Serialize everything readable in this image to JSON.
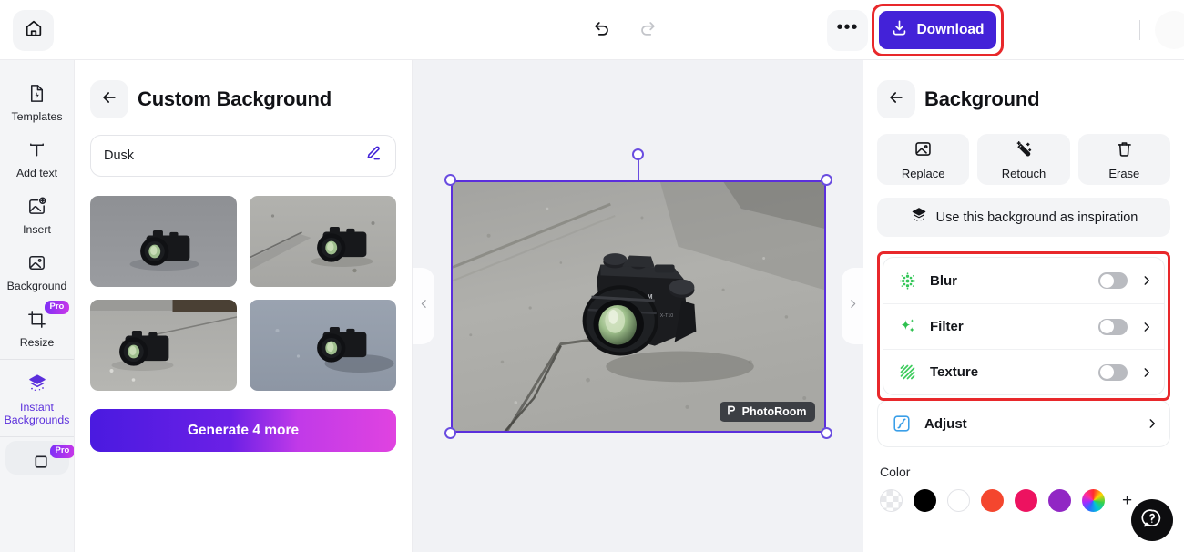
{
  "topbar": {
    "home_icon": "home-icon",
    "undo_icon": "undo-icon",
    "redo_icon": "redo-icon",
    "more_label": "•••",
    "download_label": "Download",
    "download_icon": "download-icon",
    "download_color": "#4322d8",
    "highlight_color": "#e8282b"
  },
  "rail": {
    "items": [
      {
        "label": "Templates",
        "icon": "templates-icon",
        "pro": false,
        "active": false
      },
      {
        "label": "Add text",
        "icon": "text-icon",
        "pro": false,
        "active": false
      },
      {
        "label": "Insert",
        "icon": "insert-image-icon",
        "pro": false,
        "active": false
      },
      {
        "label": "Background",
        "icon": "background-image-icon",
        "pro": false,
        "active": false
      },
      {
        "label": "Resize",
        "icon": "crop-resize-icon",
        "pro": true,
        "active": false
      },
      {
        "label": "Instant\nBackgrounds",
        "icon": "layers-sparkle-icon",
        "pro": false,
        "active": true
      }
    ],
    "pro_badge": "Pro",
    "active_color": "#5b2fdc",
    "partial_item": {
      "label": "",
      "icon": "shadow-icon",
      "pro": true
    }
  },
  "panel": {
    "back_icon": "arrow-left-icon",
    "title": "Custom Background",
    "prompt_value": "Dusk",
    "prompt_edit_icon": "pencil-edit-icon",
    "thumbnails": [
      {
        "name": "variation-1",
        "tone": "gray-smooth"
      },
      {
        "name": "variation-2",
        "tone": "concrete-crack"
      },
      {
        "name": "variation-3",
        "tone": "concrete-light"
      },
      {
        "name": "variation-4",
        "tone": "blue-gray"
      }
    ],
    "generate_label": "Generate 4 more"
  },
  "canvas": {
    "nav_prev_icon": "chevron-left-icon",
    "nav_next_icon": "chevron-right-icon",
    "watermark_label": "PhotoRoom",
    "watermark_icon": "photoroom-logo-icon",
    "selection_color": "#5b2fdc",
    "image_alt": "Fujifilm camera on concrete pavement"
  },
  "right": {
    "back_icon": "arrow-left-icon",
    "title": "Background",
    "actions": [
      {
        "label": "Replace",
        "icon": "image-icon"
      },
      {
        "label": "Retouch",
        "icon": "retouch-wand-icon"
      },
      {
        "label": "Erase",
        "icon": "trash-icon"
      }
    ],
    "inspiration_label": "Use this background as inspiration",
    "inspiration_icon": "layers-sparkle-icon",
    "effects": [
      {
        "label": "Blur",
        "icon": "blur-dots-icon",
        "icon_color": "#35c759",
        "toggle": false,
        "chevron": true
      },
      {
        "label": "Filter",
        "icon": "sparkle-icon",
        "icon_color": "#2ec04f",
        "toggle": false,
        "chevron": true
      },
      {
        "label": "Texture",
        "icon": "texture-stripes-icon",
        "icon_color": "#3fcc5e",
        "toggle": false,
        "chevron": true
      }
    ],
    "adjust": {
      "label": "Adjust",
      "icon": "curve-adjust-icon",
      "icon_color": "#3b9fe8",
      "chevron": true
    },
    "color_label": "Color",
    "swatches": [
      {
        "name": "transparent",
        "hex": "checker"
      },
      {
        "name": "black",
        "hex": "#000000"
      },
      {
        "name": "white",
        "hex": "#ffffff"
      },
      {
        "name": "red-orange",
        "hex": "#f4462e"
      },
      {
        "name": "pink",
        "hex": "#ed1260"
      },
      {
        "name": "purple",
        "hex": "#9127c4"
      },
      {
        "name": "rainbow-picker",
        "hex": "rainbow"
      }
    ],
    "add_swatch_label": "+",
    "help_icon": "help-question-icon"
  }
}
